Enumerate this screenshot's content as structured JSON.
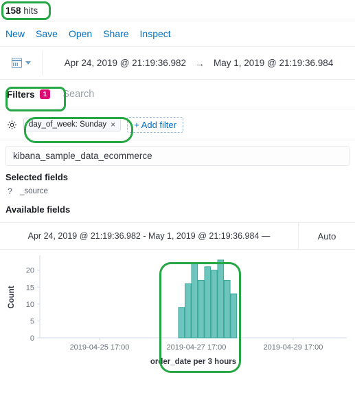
{
  "hits": {
    "count": "158",
    "label": "hits"
  },
  "nav": {
    "links": [
      {
        "label": "New",
        "name": "new"
      },
      {
        "label": "Save",
        "name": "save"
      },
      {
        "label": "Open",
        "name": "open"
      },
      {
        "label": "Share",
        "name": "share"
      },
      {
        "label": "Inspect",
        "name": "inspect"
      }
    ]
  },
  "datepicker": {
    "calendar_icon": "calendar-icon",
    "start": "Apr 24, 2019 @ 21:19:36.982",
    "arrow": "→",
    "end": "May 1, 2019 @ 21:19:36.984"
  },
  "query_bar": {
    "filters_label": "Filters",
    "filters_badge": "1",
    "search_placeholder": "Search"
  },
  "filters": {
    "gear_icon": "gear-icon",
    "pills": [
      {
        "label": "day_of_week: Sunday",
        "remove": "×"
      }
    ],
    "add_filter_label": "+ Add filter"
  },
  "sidebar": {
    "index_pattern": "kibana_sample_data_ecommerce",
    "selected_fields_title": "Selected fields",
    "selected_fields": [
      {
        "type_icon": "?",
        "name": "_source"
      }
    ],
    "available_fields_title": "Available fields"
  },
  "chart_header": {
    "range_label": "Apr 24, 2019 @ 21:19:36.982 - May 1, 2019 @ 21:19:36.984 —",
    "interval": "Auto"
  },
  "colors": {
    "bar_fill": "#6dc5be",
    "bar_stroke": "#3aa89c",
    "link": "#0071c2",
    "badge": "#dd0a73",
    "annotation": "#26a745"
  },
  "chart_data": {
    "type": "bar",
    "title": "",
    "xlabel": "order_date per 3 hours",
    "ylabel": "Count",
    "ylim": [
      0,
      24
    ],
    "yticks": [
      0,
      5,
      10,
      15,
      20
    ],
    "grid": false,
    "legend": "none",
    "xtick_labels": [
      "2019-04-25 17:00",
      "2019-04-27 17:00",
      "2019-04-29 17:00"
    ],
    "categories": [
      "2019-04-27 18:00",
      "2019-04-27 21:00",
      "2019-04-28 00:00",
      "2019-04-28 03:00",
      "2019-04-28 06:00",
      "2019-04-28 09:00",
      "2019-04-28 12:00",
      "2019-04-28 15:00",
      "2019-04-28 18:00"
    ],
    "values": [
      9,
      16,
      22,
      17,
      21,
      20,
      23,
      17,
      13
    ]
  },
  "annotations": [
    {
      "name": "hits-highlight",
      "target": "hit-count"
    },
    {
      "name": "filters-tab-highlight",
      "target": "filters-tab"
    },
    {
      "name": "filter-pill-highlight",
      "target": "filter-pill"
    },
    {
      "name": "bars-highlight",
      "target": "chart-bars"
    }
  ]
}
